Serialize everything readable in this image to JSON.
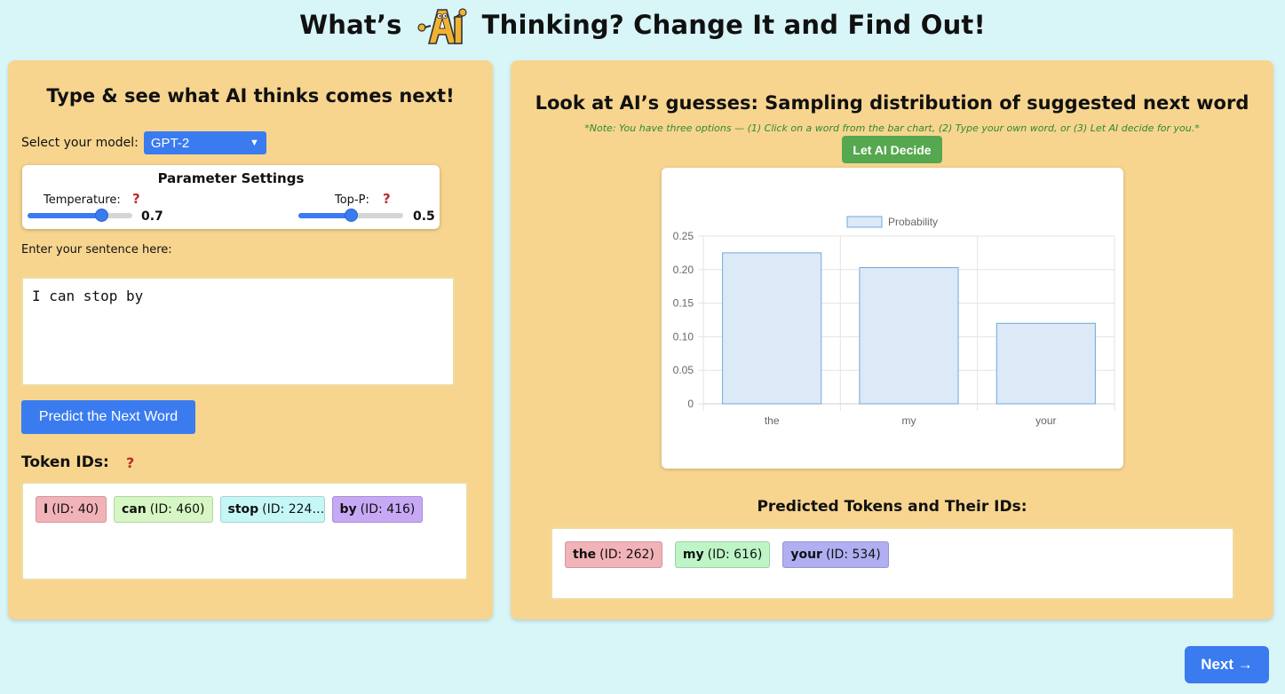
{
  "header": {
    "title_part1": "What’s",
    "logo_text": "AI",
    "title_part2": "Thinking? Change It and Find Out!"
  },
  "left": {
    "title": "Type & see what AI thinks comes next!",
    "model_label": "Select your model:",
    "model_value": "GPT-2",
    "params": {
      "title": "Parameter Settings",
      "temperature_label": "Temperature:",
      "temperature_value": "0.7",
      "temperature_fraction": 0.7,
      "topp_label": "Top-P:",
      "topp_value": "0.5",
      "topp_fraction": 0.5,
      "help_glyph": "?"
    },
    "enter_label": "Enter your sentence here:",
    "sentence": "I can stop by",
    "predict_button": "Predict the Next Word",
    "token_ids_label": "Token IDs:",
    "tokens": [
      {
        "word": "I",
        "id": "(ID: 40)",
        "color": "#f2b3b8"
      },
      {
        "word": "can",
        "id": "(ID: 460)",
        "color": "#d6f7c3"
      },
      {
        "word": "stop",
        "id": "(ID: 224…",
        "color": "#c6f7f7"
      },
      {
        "word": "by",
        "id": "(ID: 416)",
        "color": "#c7a8f5"
      }
    ]
  },
  "right": {
    "title": "Look at AI’s guesses: Sampling distribution of suggested next word",
    "note": "*Note: You have three options — (1) Click on a word from the bar chart, (2) Type your own word, or (3) Let AI decide for you.*",
    "decide_button": "Let AI Decide",
    "predicted_label": "Predicted Tokens and Their IDs:",
    "predicted": [
      {
        "word": "the",
        "id": "(ID: 262)",
        "color": "#f2b3b8"
      },
      {
        "word": "my",
        "id": "(ID: 616)",
        "color": "#bdf5c6"
      },
      {
        "word": "your",
        "id": "(ID: 534)",
        "color": "#b1aff2"
      }
    ]
  },
  "chart_data": {
    "type": "bar",
    "categories": [
      "the",
      "my",
      "your"
    ],
    "series": [
      {
        "name": "Probability",
        "values": [
          0.225,
          0.203,
          0.12
        ]
      }
    ],
    "ylim": [
      0,
      0.25
    ],
    "yticks": [
      "0",
      "0.05",
      "0.10",
      "0.15",
      "0.20",
      "0.25"
    ],
    "grid": true,
    "legend": "top-center",
    "bar_fill": "#dceaf7",
    "bar_stroke": "#6fa8dc"
  },
  "next_button": "Next →"
}
